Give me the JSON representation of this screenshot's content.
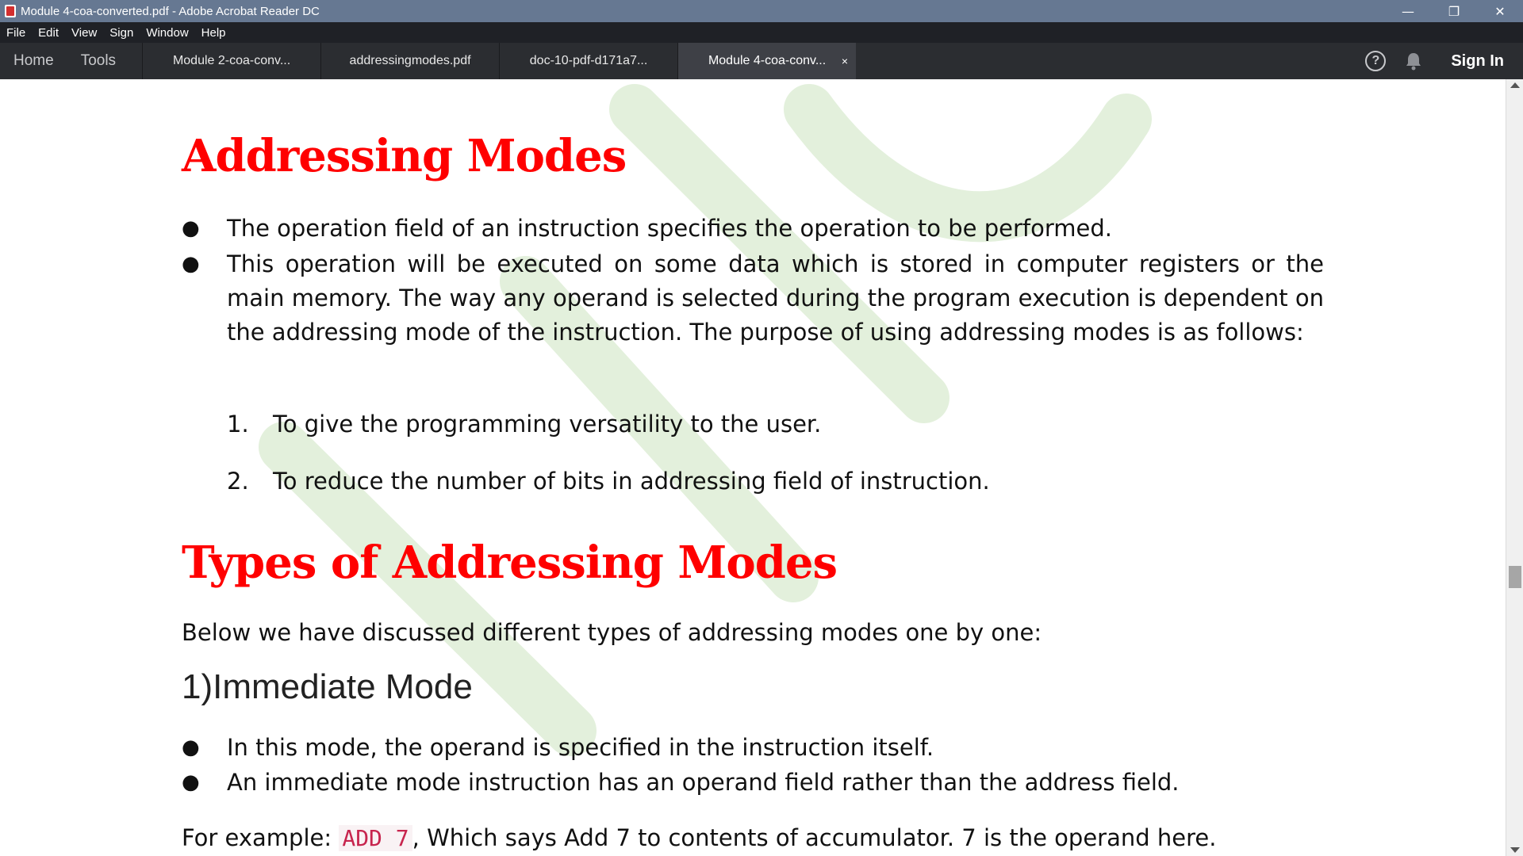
{
  "window": {
    "title": "Module 4-coa-converted.pdf - Adobe Acrobat Reader DC",
    "minimize": "—",
    "maximize": "❐",
    "close": "✕"
  },
  "menu": [
    "File",
    "Edit",
    "View",
    "Sign",
    "Window",
    "Help"
  ],
  "nav": {
    "home": "Home",
    "tools": "Tools"
  },
  "tabs": [
    {
      "label": "Module 2-coa-conv..."
    },
    {
      "label": "addressingmodes.pdf"
    },
    {
      "label": "doc-10-pdf-d171a7..."
    },
    {
      "label": "Module 4-coa-conv...",
      "close": "×"
    }
  ],
  "toolbar": {
    "help_glyph": "?",
    "sign_in": "Sign In"
  },
  "document": {
    "heading1": "Addressing Modes",
    "bullets1": [
      "The operation field of an instruction specifies the operation to be performed.",
      "This operation will be executed on some data which is stored in computer registers or the main memory. The way any operand is selected during the program execution is dependent on the addressing mode of the instruction. The purpose of using addressing modes is as follows:"
    ],
    "bullet_glyph": "●",
    "purposes": [
      {
        "num": "1.",
        "text": "To give the programming versatility to the user."
      },
      {
        "num": "2.",
        "text": "To reduce the number of bits in addressing field of instruction."
      }
    ],
    "heading2": "Types of Addressing Modes",
    "intro": "Below we have discussed different types of addressing modes one by one:",
    "subheading": "1)Immediate Mode",
    "bullets2": [
      "In this mode, the operand is specified in the instruction itself.",
      "An immediate mode instruction has an operand field rather than the address field."
    ],
    "example_prefix": "For example: ",
    "example_code": "ADD 7",
    "example_suffix": ", Which says Add 7 to contents of accumulator. 7 is the operand here."
  },
  "colors": {
    "heading": "#ff0000",
    "watermark": "#e3f0dc",
    "titlebar": "#667892"
  }
}
